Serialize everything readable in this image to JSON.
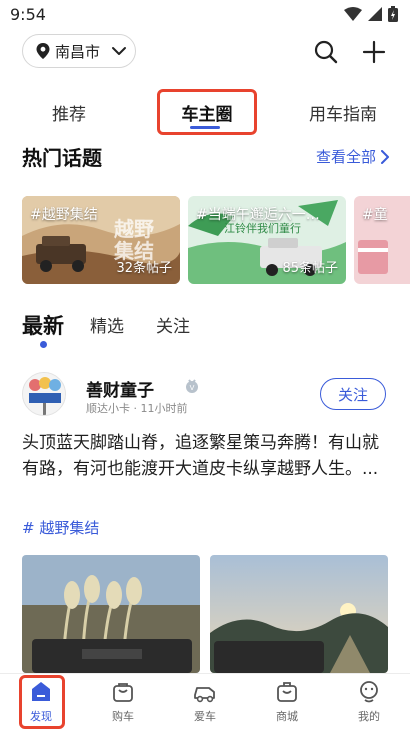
{
  "status_bar": {
    "time": "9:54"
  },
  "location": {
    "city": "南昌市"
  },
  "tabs": [
    {
      "label": "推荐",
      "active": false
    },
    {
      "label": "车主圈",
      "active": true
    },
    {
      "label": "用车指南",
      "active": false
    }
  ],
  "hot_topics": {
    "title": "热门话题",
    "see_all": "查看全部",
    "items": [
      {
        "name": "#越野集结",
        "count": "32条帖子"
      },
      {
        "name": "#当端午邂逅六一…",
        "count": "85条帖子"
      },
      {
        "name": "#童",
        "count": ""
      }
    ]
  },
  "feed_tabs": [
    {
      "label": "最新",
      "active": true
    },
    {
      "label": "精选",
      "active": false
    },
    {
      "label": "关注",
      "active": false
    }
  ],
  "post": {
    "author": "善财童子",
    "meta": "顺达小卡 · 11小时前",
    "follow_label": "关注",
    "text": "头顶蓝天脚踏山脊，追逐繁星策马奔腾！有山就有路，有河也能渡开大道皮卡纵享越野人生。...",
    "tag": "# 越野集结"
  },
  "bottom_nav": [
    {
      "label": "发现",
      "icon": "discover-icon",
      "active": true
    },
    {
      "label": "购车",
      "icon": "buy-car-icon",
      "active": false
    },
    {
      "label": "爱车",
      "icon": "my-car-icon",
      "active": false
    },
    {
      "label": "商城",
      "icon": "mall-icon",
      "active": false
    },
    {
      "label": "我的",
      "icon": "profile-icon",
      "active": false
    }
  ],
  "colors": {
    "accent": "#3a5bd9",
    "highlight": "#e8432e"
  }
}
